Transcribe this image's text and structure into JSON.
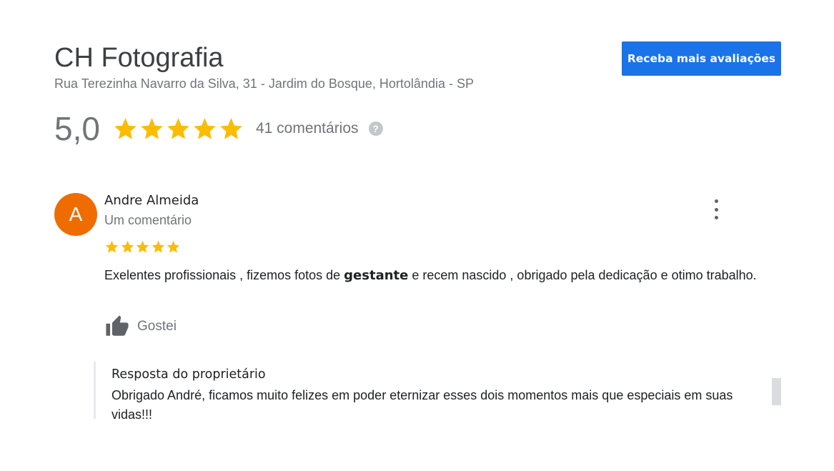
{
  "business": {
    "name": "CH Fotografia",
    "address": "Rua Terezinha Navarro da Silva, 31 - Jardim do Bosque, Hortolândia - SP"
  },
  "cta": {
    "label": "Receba mais avaliações"
  },
  "rating": {
    "value": "5,0",
    "stars": 5,
    "count_label": "41 comentários",
    "help_icon": "?"
  },
  "review": {
    "avatar_letter": "A",
    "avatar_color": "#ef6c00",
    "author": "Andre Almeida",
    "author_sub": "Um comentário",
    "stars": 5,
    "text_before": "Exelentes profissionais , fizemos fotos de ",
    "text_bold": "gestante",
    "text_after": " e recem nascido , obrigado pela dedicação e otimo trabalho.",
    "like_label": "Gostei"
  },
  "owner_reply": {
    "title": "Resposta do proprietário",
    "text": "Obrigado André, ficamos muito felizes em poder eternizar esses dois momentos mais que especiais em suas vidas!!!"
  },
  "colors": {
    "accent": "#1a73e8",
    "star": "#fbbc04",
    "muted_text": "#70757a"
  },
  "icons": {
    "star": "star-icon",
    "thumbs_up": "thumbs-up-icon",
    "more": "more-vert-icon",
    "help": "help-icon"
  }
}
